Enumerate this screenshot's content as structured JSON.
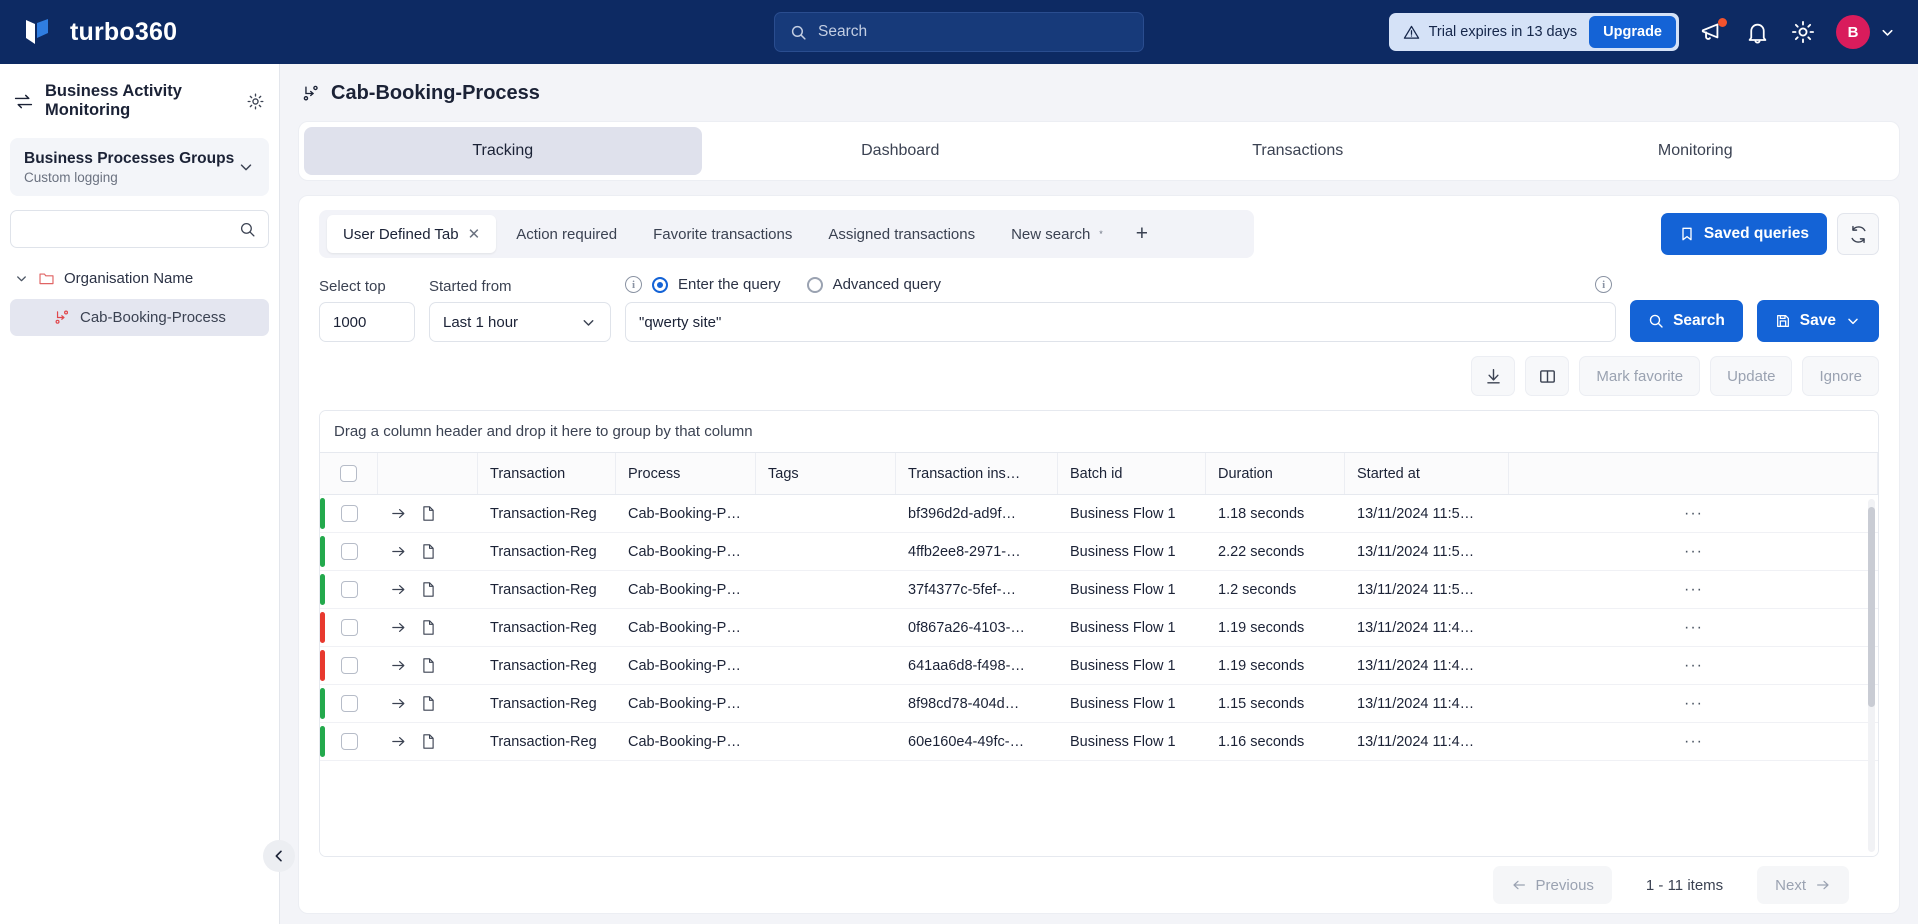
{
  "topbar": {
    "brand": "turbo360",
    "search_placeholder": "Search",
    "trial_text": "Trial expires in 13 days",
    "upgrade_label": "Upgrade",
    "avatar_initial": "B",
    "accent_blue": "#1463d6",
    "header_bg": "#0d2a63",
    "avatar_bg": "#d91c5c"
  },
  "sidebar": {
    "title": "Business Activity Monitoring",
    "group_title": "Business Processes Groups",
    "group_subtitle": "Custom logging",
    "search_value": "",
    "search_placeholder": "",
    "tree": {
      "org_label": "Organisation Name",
      "child_label": "Cab-Booking-Process"
    }
  },
  "main": {
    "page_title": "Cab-Booking-Process",
    "tabs": [
      {
        "label": "Tracking",
        "active": true
      },
      {
        "label": "Dashboard",
        "active": false
      },
      {
        "label": "Transactions",
        "active": false
      },
      {
        "label": "Monitoring",
        "active": false
      }
    ],
    "query_tabs": [
      {
        "label": "User Defined Tab",
        "active": true,
        "closable": true
      },
      {
        "label": "Action required",
        "active": false,
        "closable": false
      },
      {
        "label": "Favorite transactions",
        "active": false,
        "closable": false
      },
      {
        "label": "Assigned transactions",
        "active": false,
        "closable": false
      },
      {
        "label": "New search",
        "active": false,
        "closable": false,
        "star": true
      }
    ],
    "add_tab_label": "+",
    "saved_queries_label": "Saved queries",
    "form": {
      "select_top_label": "Select top",
      "select_top_value": "1000",
      "started_from_label": "Started from",
      "started_from_value": "Last 1 hour",
      "radio_simple_label": "Enter the query",
      "radio_advanced_label": "Advanced query",
      "radio_selected": "simple",
      "query_value": "\"qwerty site\"",
      "search_label": "Search",
      "save_label": "Save"
    },
    "tools": {
      "mark_favorite": "Mark favorite",
      "update": "Update",
      "ignore": "Ignore"
    },
    "grid": {
      "group_hint": "Drag a column header and drop it here to group by that column",
      "columns": [
        "",
        "",
        "Transaction",
        "Process",
        "Tags",
        "Transaction ins…",
        "Batch id",
        "Duration",
        "Started at",
        ""
      ],
      "rows": [
        {
          "status": "green",
          "transaction": "Transaction-Reg",
          "process": "Cab-Booking-P…",
          "tags": "",
          "instance": "bf396d2d-ad9f…",
          "batch": "Business Flow 1",
          "duration": "1.18 seconds",
          "started": "13/11/2024 11:5…"
        },
        {
          "status": "green",
          "transaction": "Transaction-Reg",
          "process": "Cab-Booking-P…",
          "tags": "",
          "instance": "4ffb2ee8-2971-…",
          "batch": "Business Flow 1",
          "duration": "2.22 seconds",
          "started": "13/11/2024 11:5…"
        },
        {
          "status": "green",
          "transaction": "Transaction-Reg",
          "process": "Cab-Booking-P…",
          "tags": "",
          "instance": "37f4377c-5fef-…",
          "batch": "Business Flow 1",
          "duration": "1.2 seconds",
          "started": "13/11/2024 11:5…"
        },
        {
          "status": "red",
          "transaction": "Transaction-Reg",
          "process": "Cab-Booking-P…",
          "tags": "",
          "instance": "0f867a26-4103-…",
          "batch": "Business Flow 1",
          "duration": "1.19 seconds",
          "started": "13/11/2024 11:4…"
        },
        {
          "status": "red",
          "transaction": "Transaction-Reg",
          "process": "Cab-Booking-P…",
          "tags": "",
          "instance": "641aa6d8-f498-…",
          "batch": "Business Flow 1",
          "duration": "1.19 seconds",
          "started": "13/11/2024 11:4…"
        },
        {
          "status": "green",
          "transaction": "Transaction-Reg",
          "process": "Cab-Booking-P…",
          "tags": "",
          "instance": "8f98cd78-404d…",
          "batch": "Business Flow 1",
          "duration": "1.15 seconds",
          "started": "13/11/2024 11:4…"
        },
        {
          "status": "green",
          "transaction": "Transaction-Reg",
          "process": "Cab-Booking-P…",
          "tags": "",
          "instance": "60e160e4-49fc-…",
          "batch": "Business Flow 1",
          "duration": "1.16 seconds",
          "started": "13/11/2024 11:4…"
        }
      ],
      "row_more_glyph": "···",
      "status_colors": {
        "green": "#23a94c",
        "red": "#e8392e"
      }
    },
    "pager": {
      "previous_label": "Previous",
      "count_label": "1 - 11 items",
      "next_label": "Next"
    }
  }
}
